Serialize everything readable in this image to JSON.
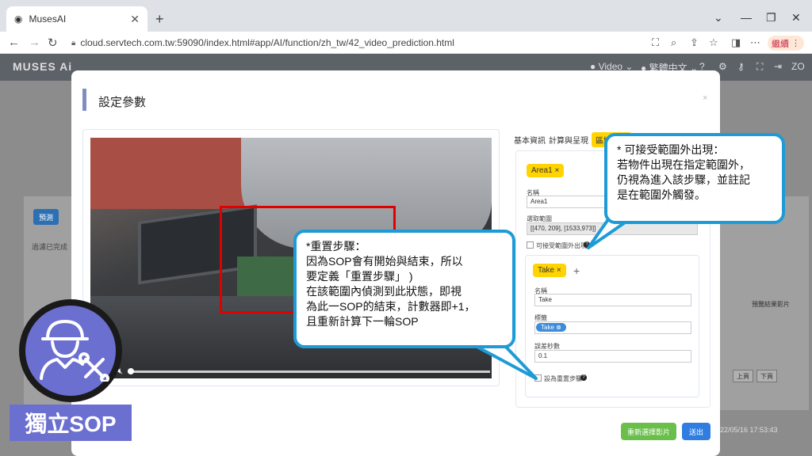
{
  "browser": {
    "tab_title": "MusesAI",
    "url": "cloud.servtech.com.tw:59090/index.html#app/AI/function/zh_tw/42_video_prediction.html",
    "profile_label": "繼續"
  },
  "app": {
    "logo": "MUSES Ai",
    "header_video": "Video",
    "header_lang": "繁體中文",
    "header_user": "ZO"
  },
  "background": {
    "predict_button": "預測",
    "filter_text": "過濾已完成",
    "preview_label": "預覽結果影片",
    "prev_page": "上頁",
    "next_page": "下頁",
    "timestamp": "22/05/16 17:53:43"
  },
  "modal": {
    "title": "設定參數",
    "close": "×",
    "tabs": [
      "基本資訊",
      "計算與呈現",
      "區域設定"
    ],
    "area_chip": "Area1",
    "name_label": "名稱",
    "name_value": "Area1",
    "range_label": "選取範圍",
    "range_value": "[[470,  209],  [1533,973]]",
    "accept_outside_label": "可接受範圍外出現",
    "step_chip": "Take",
    "step_name_label": "名稱",
    "step_name_value": "Take",
    "tag_label": "標籤",
    "tag_value": "Take",
    "delay_label": "誤差秒數",
    "delay_value": "0.1",
    "reset_step_label": "設為重置步驟",
    "reselect_button": "重新選擇影片",
    "submit_button": "送出"
  },
  "callouts": {
    "outside": [
      "* 可接受範圍外出現：",
      "若物件出現在指定範圍外，",
      "仍視為進入該步驟，並註記",
      "是在範圍外觸發。"
    ],
    "reset": [
      "*重置步驟：",
      "因為SOP會有開始與結束，所以",
      "要定義「重置步驟」 )",
      "在該範圍內偵測到此狀態，即視",
      "為此一SOP的結束，計數器即+1，",
      "且重新計算下一輪SOP"
    ]
  },
  "badge": {
    "label": "獨立SOP",
    "icon": "worker-wrench-icon"
  },
  "video": {
    "progress": 0
  },
  "colors": {
    "callout_border": "#1e9bd7",
    "badge": "#6b6fd0",
    "chip": "#ffd400",
    "roi": "#e00000"
  }
}
